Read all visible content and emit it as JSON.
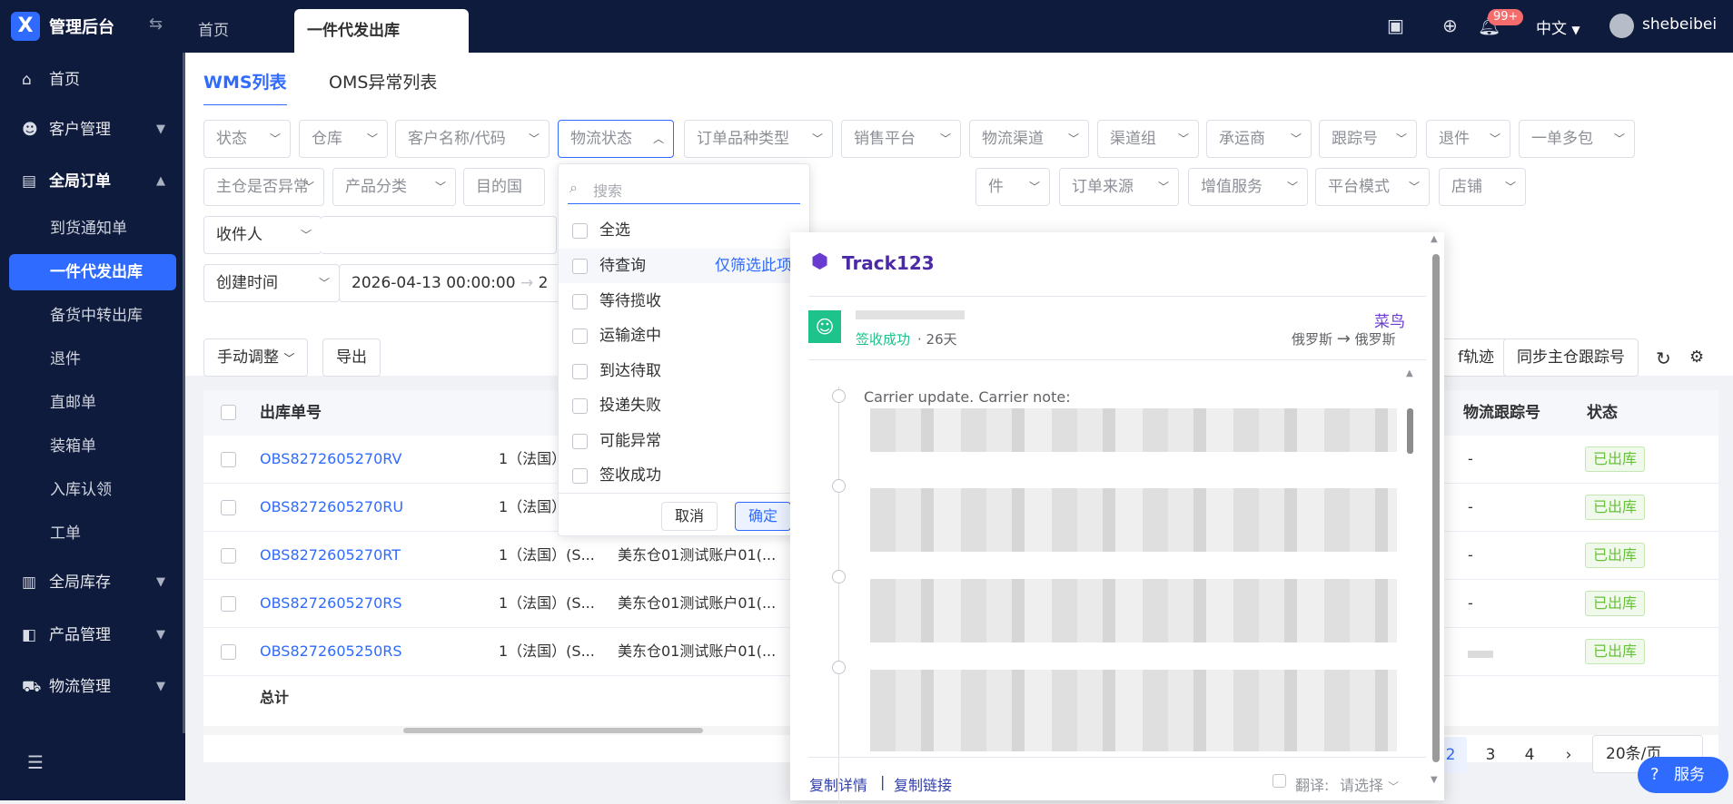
{
  "app": {
    "name": "管理后台",
    "logo": "X"
  },
  "topbar": {
    "tabs": [
      {
        "label": "首页"
      },
      {
        "label": "一件代发出库"
      }
    ],
    "notification_count": "99+",
    "language": "中文",
    "username": "shebeibei"
  },
  "sidebar": {
    "items": [
      {
        "label": "首页",
        "icon": "home-icon"
      },
      {
        "label": "客户管理",
        "icon": "user-icon"
      },
      {
        "label": "全局订单",
        "icon": "order-icon"
      },
      {
        "label": "全局库存",
        "icon": "warehouse-icon"
      },
      {
        "label": "产品管理",
        "icon": "bag-icon"
      },
      {
        "label": "物流管理",
        "icon": "truck-icon"
      }
    ],
    "sub_items": [
      "到货通知单",
      "一件代发出库",
      "备货中转出库",
      "退件",
      "直邮单",
      "装箱单",
      "入库认领",
      "工单"
    ]
  },
  "subtabs": {
    "wms": "WMS列表",
    "oms": "OMS异常列表"
  },
  "filters": {
    "row1": [
      "状态",
      "仓库",
      "客户名称/代码",
      "物流状态",
      "订单品种类型",
      "销售平台",
      "物流渠道",
      "渠道组",
      "承运商",
      "跟踪号",
      "退件",
      "一单多包"
    ],
    "row2": [
      "主仓是否异常",
      "产品分类",
      "目的国",
      "件",
      "订单来源",
      "增值服务",
      "平台模式",
      "店铺"
    ],
    "consignee": "收件人",
    "time_type": "创建时间",
    "time_start": "2026-04-13 00:00:00",
    "time_end_partial": "2"
  },
  "toolbar": {
    "manual_adjust": "手动调整",
    "export": "导出",
    "track_partial": "f轨迹",
    "sync": "同步主仓跟踪号"
  },
  "table": {
    "headers": {
      "order_no": "出库单号",
      "tracking": "物流跟踪号",
      "status": "状态"
    },
    "rows": [
      {
        "order_no": "OBS8272605270RV",
        "col2": "1（法国）",
        "col3": "",
        "tracking": "-",
        "status": "已出库"
      },
      {
        "order_no": "OBS8272605270RU",
        "col2": "1（法国）",
        "col3": "",
        "tracking": "-",
        "status": "已出库"
      },
      {
        "order_no": "OBS8272605270RT",
        "col2": "1（法国）(S...",
        "col3": "美东仓01测试账户01(...",
        "tracking": "-",
        "status": "已出库"
      },
      {
        "order_no": "OBS8272605270RS",
        "col2": "1（法国）(S...",
        "col3": "美东仓01测试账户01(...",
        "tracking": "-",
        "status": "已出库"
      },
      {
        "order_no": "OBS8272605250RS",
        "col2": "1（法国）(S...",
        "col3": "美东仓01测试账户01(...",
        "tracking": "",
        "status": "已出库"
      }
    ],
    "total_label": "总计"
  },
  "pager": {
    "pages": [
      "2",
      "3",
      "4"
    ],
    "next": "›",
    "page_size": "20条/页"
  },
  "dropdown": {
    "search_placeholder": "搜索",
    "options": [
      "全选",
      "待查询",
      "等待揽收",
      "运输途中",
      "到达待取",
      "投递失败",
      "可能异常",
      "签收成功"
    ],
    "only_this": "仅筛选此项",
    "cancel": "取消",
    "confirm": "确定"
  },
  "track": {
    "brand": "Track123",
    "carrier": "菜鸟",
    "status": "签收成功",
    "days": "26天",
    "from": "俄罗斯",
    "to": "俄罗斯",
    "event_text": "Carrier update. Carrier note:",
    "copy_detail": "复制详情",
    "copy_link": "复制链接",
    "translate_label": "翻译:",
    "translate_placeholder": "请选择"
  },
  "chat": {
    "label": "服务"
  }
}
